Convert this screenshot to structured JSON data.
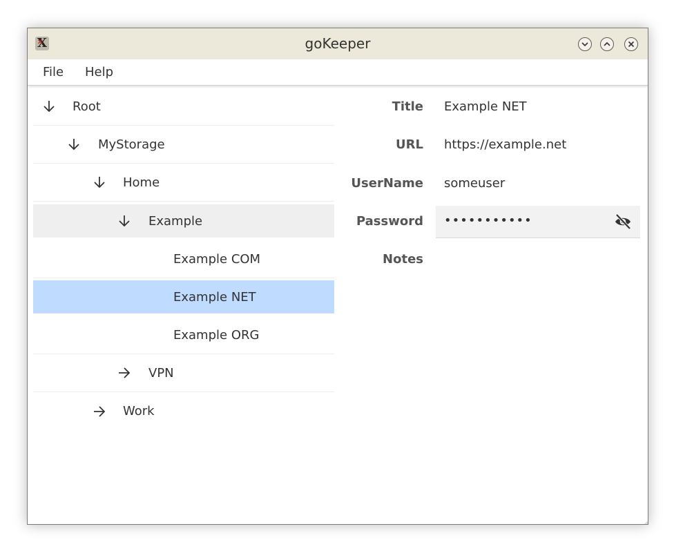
{
  "window": {
    "title": "goKeeper",
    "app_icon": "x-app-icon",
    "controls": [
      "minimize-icon",
      "maximize-icon",
      "close-icon"
    ]
  },
  "menu": {
    "items": [
      {
        "label": "File"
      },
      {
        "label": "Help"
      }
    ]
  },
  "tree": {
    "nodes": [
      {
        "label": "Root",
        "expanded": true,
        "icon": "arrow-down-icon"
      },
      {
        "label": "MyStorage",
        "expanded": true,
        "icon": "arrow-down-icon"
      },
      {
        "label": "Home",
        "expanded": true,
        "icon": "arrow-down-icon"
      },
      {
        "label": "Example",
        "expanded": true,
        "icon": "arrow-down-icon",
        "state": "hover"
      },
      {
        "label": "Example COM",
        "icon": ""
      },
      {
        "label": "Example NET",
        "icon": "",
        "state": "selected"
      },
      {
        "label": "Example ORG",
        "icon": ""
      },
      {
        "label": "VPN",
        "expanded": false,
        "icon": "arrow-right-icon"
      },
      {
        "label": "Work",
        "expanded": false,
        "icon": "arrow-right-icon"
      }
    ]
  },
  "details": {
    "title_label": "Title",
    "title_value": "Example NET",
    "url_label": "URL",
    "url_value": "https://example.net",
    "username_label": "UserName",
    "username_value": "someuser",
    "password_label": "Password",
    "password_value": "•••••••••••",
    "password_toggle_icon": "eye-slash-icon",
    "notes_label": "Notes"
  },
  "colors": {
    "titlebar": "#ece9da",
    "selected_row": "#bfdbff",
    "hover_row": "#efefef"
  }
}
